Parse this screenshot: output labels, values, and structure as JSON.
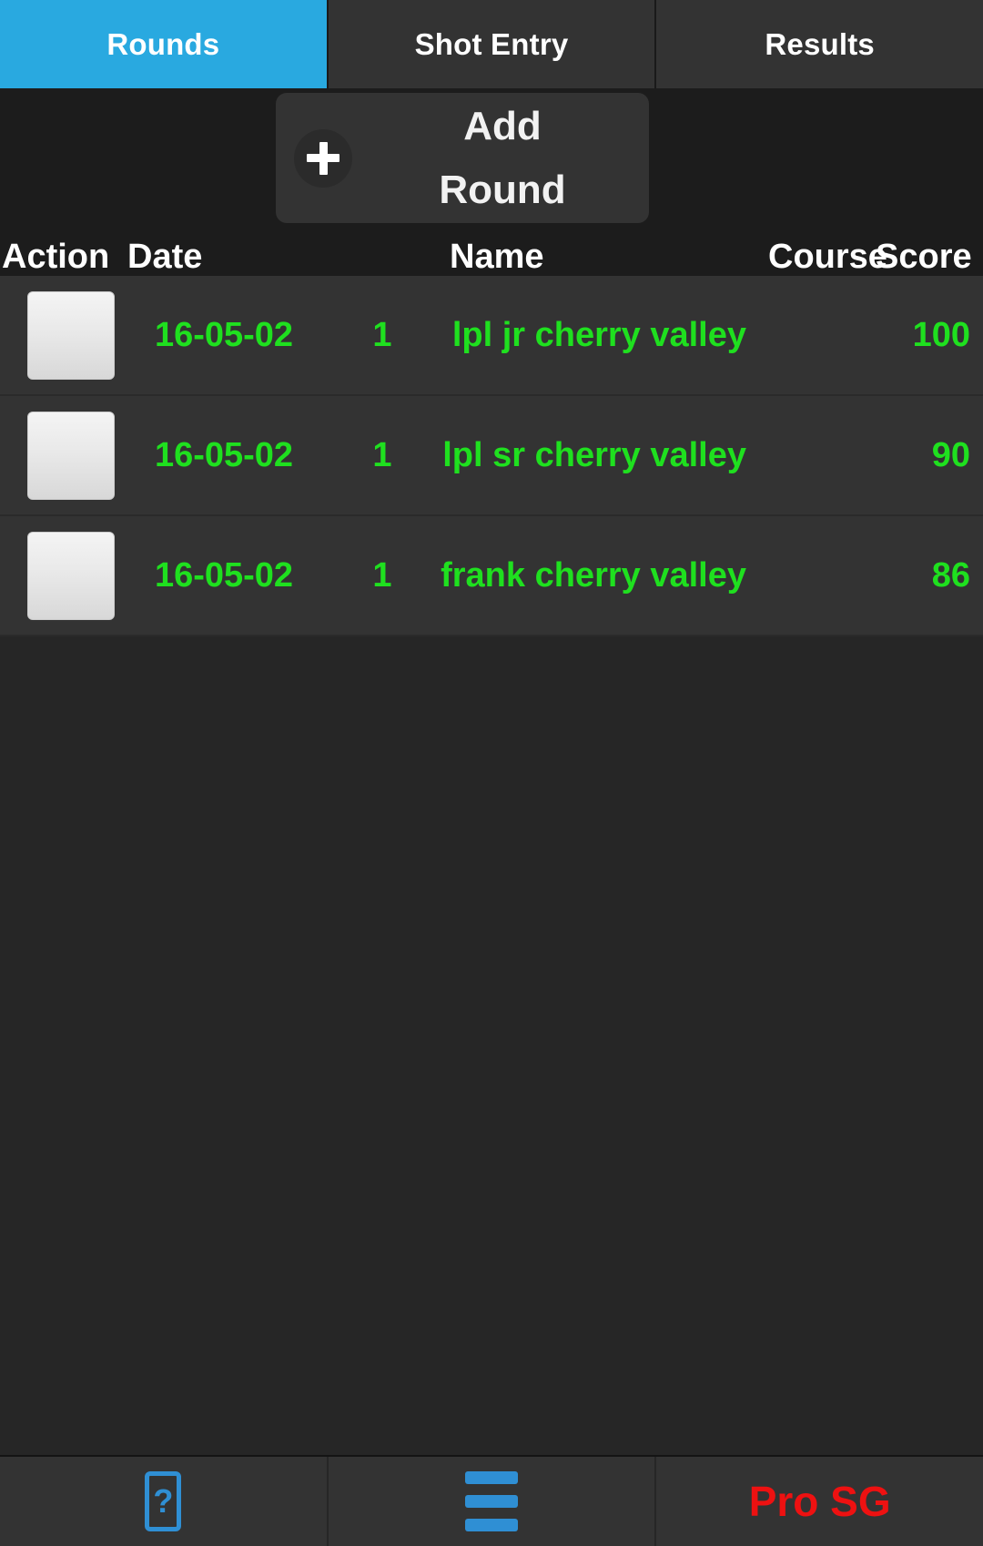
{
  "tabs": [
    {
      "label": "Rounds",
      "active": true
    },
    {
      "label": "Shot Entry",
      "active": false
    },
    {
      "label": "Results",
      "active": false
    }
  ],
  "add_round": {
    "label": "Add\nRound",
    "line1": "Add",
    "line2": "Round",
    "icon": "plus-icon"
  },
  "table": {
    "headers": {
      "action": "Action",
      "date": "Date",
      "name": "Name",
      "course": "Course",
      "score": "Score"
    },
    "rows": [
      {
        "action": "",
        "date": "16-05-02",
        "num": "1",
        "name": "lpl jr cherry valley",
        "course": "",
        "score": "100"
      },
      {
        "action": "",
        "date": "16-05-02",
        "num": "1",
        "name": "lpl sr cherry valley",
        "course": "",
        "score": "90"
      },
      {
        "action": "",
        "date": "16-05-02",
        "num": "1",
        "name": "frank cherry valley",
        "course": "",
        "score": "86"
      }
    ]
  },
  "bottom_bar": {
    "help": {
      "icon": "help-phone-icon",
      "glyph": "?"
    },
    "menu": {
      "icon": "hamburger-menu-icon"
    },
    "brand": "Pro SG"
  },
  "colors": {
    "accent_blue": "#29a9e0",
    "icon_blue": "#2f8fd4",
    "row_text_green": "#1fe01f",
    "brand_red": "#ee1111",
    "row_bg": "#333333",
    "page_bg": "#262626",
    "bar_bg": "#1c1c1c"
  }
}
